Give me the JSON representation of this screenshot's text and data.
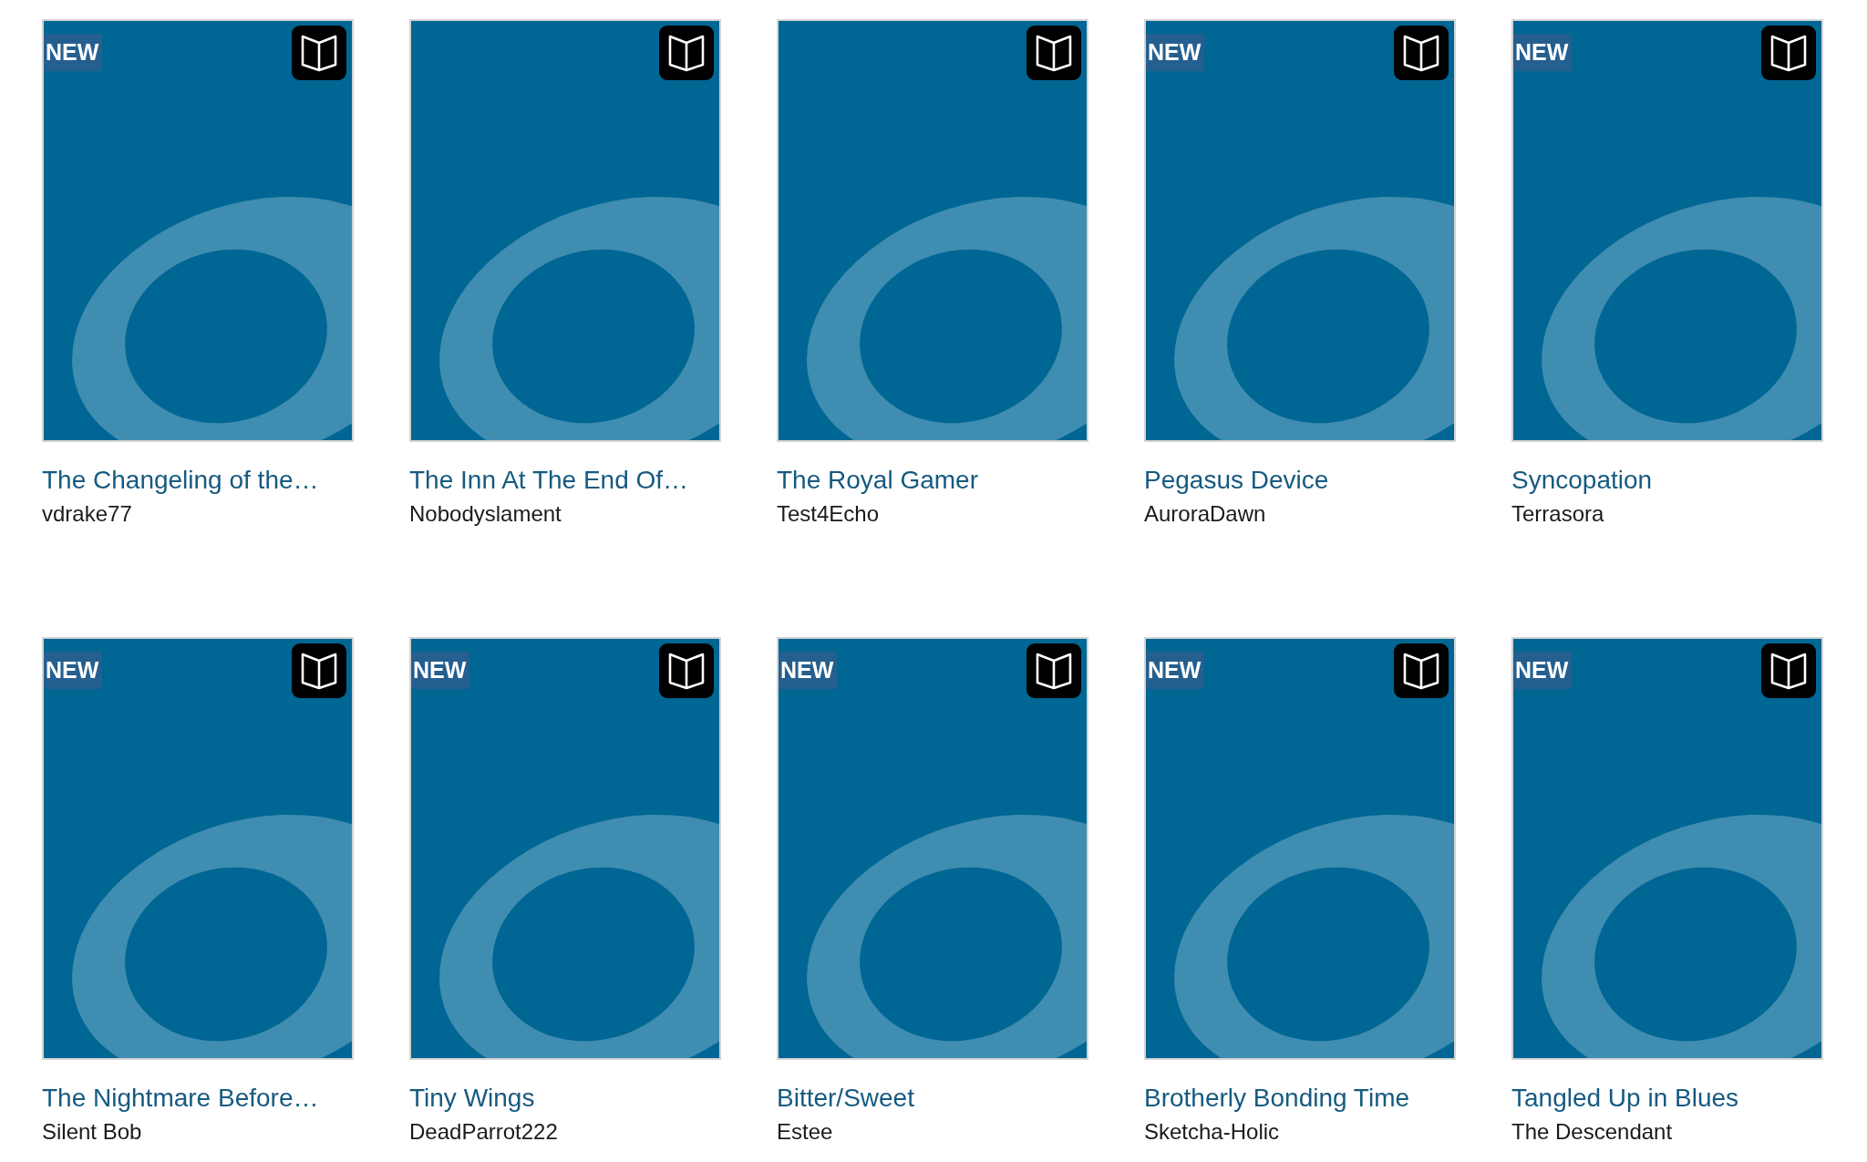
{
  "books": [
    {
      "title": "The Changeling of the…",
      "author": "vdrake77",
      "badge": "NEW"
    },
    {
      "title": "The Inn At The End Of…",
      "author": "Nobodyslament"
    },
    {
      "title": "The Royal Gamer",
      "author": "Test4Echo"
    },
    {
      "title": "Pegasus Device",
      "author": "AuroraDawn",
      "badge": "NEW"
    },
    {
      "title": "Syncopation",
      "author": "Terrasora",
      "badge": "NEW"
    },
    {
      "title": "The Nightmare Before…",
      "author": "Silent Bob",
      "badge": "NEW"
    },
    {
      "title": "Tiny Wings",
      "author": "DeadParrot222",
      "badge": "NEW"
    },
    {
      "title": "Bitter/Sweet",
      "author": "Estee",
      "badge": "NEW"
    },
    {
      "title": "Brotherly Bonding Time",
      "author": "Sketcha-Holic",
      "badge": "NEW"
    },
    {
      "title": "Tangled Up in Blues",
      "author": "The Descendant",
      "badge": "NEW"
    }
  ]
}
